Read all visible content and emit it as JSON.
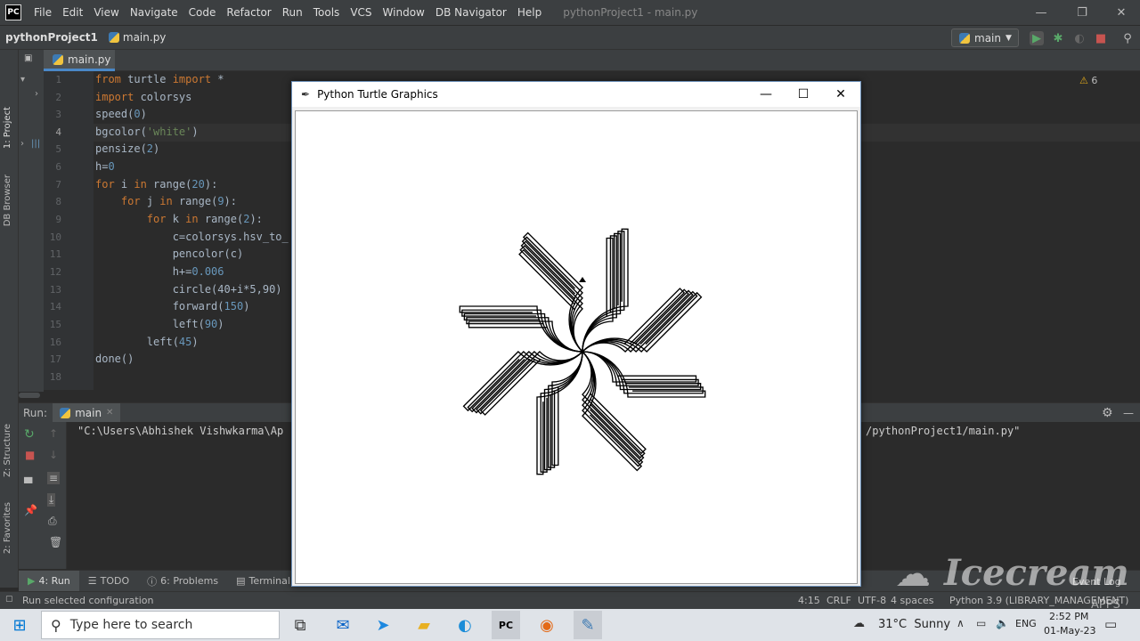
{
  "menubar": {
    "logo": "PC",
    "items": [
      "File",
      "Edit",
      "View",
      "Navigate",
      "Code",
      "Refactor",
      "Run",
      "Tools",
      "VCS",
      "Window",
      "DB Navigator",
      "Help"
    ],
    "window_title": "pythonProject1 - main.py"
  },
  "navbar": {
    "project": "pythonProject1",
    "file": "main.py",
    "run_config": "main"
  },
  "sidebar": {
    "project_tab": "1: Project",
    "db_tab": "DB Browser",
    "structure_tab": "Z: Structure",
    "favorites_tab": "2: Favorites"
  },
  "editor": {
    "tab": "main.py",
    "inspection_count": "6",
    "line_numbers": [
      "1",
      "2",
      "3",
      "4",
      "5",
      "6",
      "7",
      "8",
      "9",
      "10",
      "11",
      "12",
      "13",
      "14",
      "15",
      "16",
      "17",
      "18"
    ],
    "visible_code_fragments": [
      "c=colorsys.hsv_to_",
      "circle(40+i*5,90)"
    ]
  },
  "run_panel": {
    "label": "Run:",
    "config": "main",
    "console_left": "\"C:\\Users\\Abhishek Vishwkarma\\Ap",
    "console_right": "/pythonProject1/main.py\""
  },
  "bottom_tabs": [
    "4: Run",
    "TODO",
    "6: Problems",
    "Terminal"
  ],
  "statusbar": {
    "message": "Run selected configuration",
    "position": "4:15",
    "line_sep": "CRLF",
    "encoding": "UTF-8",
    "spaces": "4 spaces",
    "interpreter": "Python 3.9 (LIBRARY_MANAGEMENT)",
    "event_log": "Event Log"
  },
  "turtle_window": {
    "title": "Python Turtle Graphics"
  },
  "taskbar": {
    "search_placeholder": "Type here to search",
    "weather": "31°C  Sunny",
    "lang": "ENG",
    "time": "2:52 PM",
    "date": "01-May-23"
  },
  "watermark": {
    "text": "Icecream",
    "sub": "APPS"
  },
  "colors": {
    "ide_bg": "#2b2b2b",
    "panel_bg": "#3c3f41",
    "keyword": "#cc7832",
    "number": "#6897bb",
    "string": "#6a8759",
    "accent": "#4a88c7"
  }
}
